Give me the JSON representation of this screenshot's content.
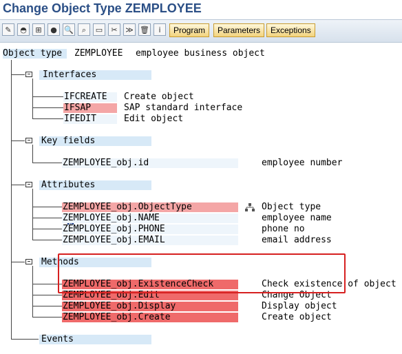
{
  "window": {
    "title": "Change Object Type ZEMPLOYEE"
  },
  "toolbar": {
    "icons": [
      "edit-icon",
      "unknown-icon",
      "hierarchy-icon",
      "stop-icon",
      "find-icon",
      "find-next-icon",
      "new-icon",
      "cut-icon",
      "expand-icon",
      "delete-icon",
      "info-icon"
    ],
    "buttons": [
      "Program",
      "Parameters",
      "Exceptions"
    ]
  },
  "object": {
    "label": "Object type",
    "name": "ZEMPLOYEE",
    "description": "employee business object"
  },
  "interfaces": {
    "label": "Interfaces",
    "items": [
      {
        "name": "IFCREATE",
        "description": "Create object"
      },
      {
        "name": "IFSAP",
        "description": "SAP standard interface"
      },
      {
        "name": "IFEDIT",
        "description": "Edit object"
      }
    ]
  },
  "key_fields": {
    "label": "Key fields",
    "items": [
      {
        "name": "ZEMPLOYEE_obj.id",
        "description": "employee number"
      }
    ]
  },
  "attributes": {
    "label": "Attributes",
    "cursor_char": "b",
    "items": [
      {
        "name": "ZEMPLOYEE_obj.ObjectType",
        "description": "Object type"
      },
      {
        "name": "ZEMPLOYEE_obj.NAME",
        "description": "employee name"
      },
      {
        "name": "ZEMPLOYEE_obj.PHONE",
        "description": "phone no"
      },
      {
        "name": "ZEMPLOYEE_obj.EMAIL",
        "description": "email address"
      }
    ]
  },
  "methods": {
    "label": "Methods",
    "items": [
      {
        "name": "ZEMPLOYEE_obj.ExistenceCheck",
        "description": "Check existence of object"
      },
      {
        "name": "ZEMPLOYEE_obj.Edit",
        "description": "Change Object"
      },
      {
        "name": "ZEMPLOYEE_obj.Display",
        "description": "Display object"
      },
      {
        "name": "ZEMPLOYEE_obj.Create",
        "description": "Create object"
      }
    ]
  },
  "events": {
    "label": "Events"
  },
  "colors": {
    "title": "#2b4f86",
    "node_highlight": "#d7e9f7",
    "red_highlight": "#f4a6a6",
    "bright_red": "#ef6a6a",
    "frame": "#d61f1f"
  }
}
